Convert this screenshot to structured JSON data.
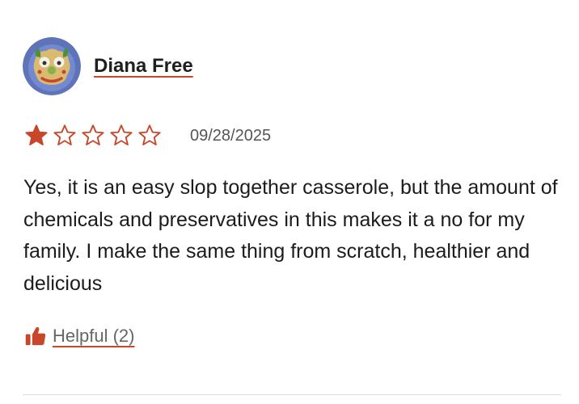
{
  "review": {
    "author_name": "Diana Free",
    "avatar_icon": "food-face-avatar-icon",
    "rating": {
      "value": 1,
      "max": 5
    },
    "date": "09/28/2025",
    "body": "Yes, it is an easy slop together casserole, but the amount of chemicals and preservatives in this makes it a no for my family. I make the same thing from scratch, healthier and delicious",
    "helpful_label": "Helpful (2)",
    "helpful_icon": "thumbs-up-icon"
  },
  "colors": {
    "accent": "#c8472a",
    "text": "#1c1c1c",
    "muted": "#666666",
    "divider": "#dddddd"
  }
}
